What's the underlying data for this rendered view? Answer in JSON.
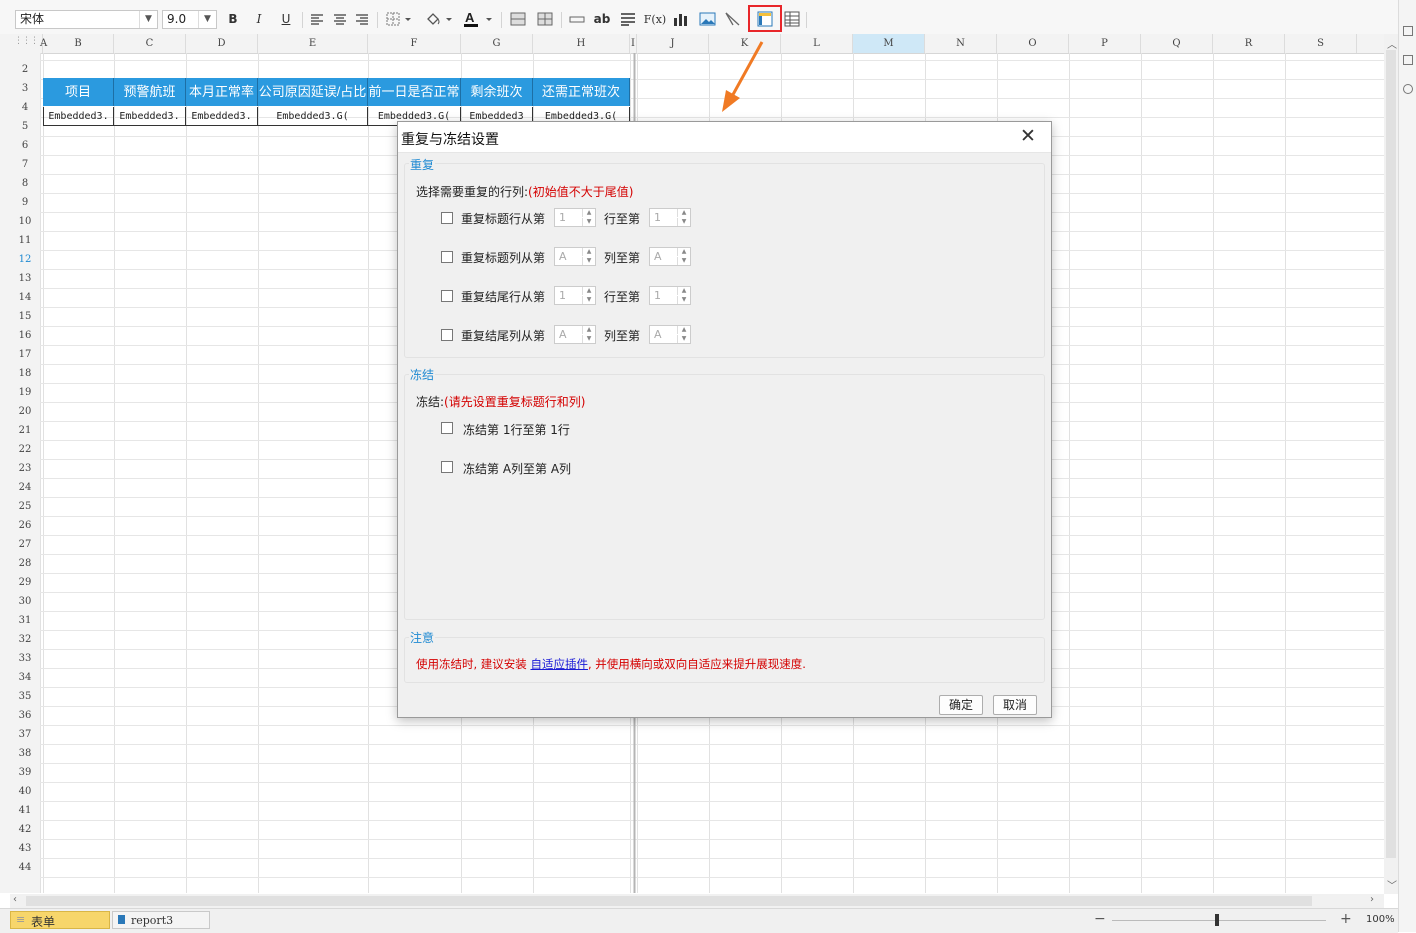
{
  "toolbar": {
    "font_name": "宋体",
    "font_size": "9.0",
    "bold_label": "B",
    "italic_label": "I",
    "underline_label": "U",
    "ab_label": "ab",
    "formula_label": "F(x)"
  },
  "columns": [
    "A",
    "B",
    "C",
    "D",
    "E",
    "F",
    "G",
    "H",
    "I",
    "J",
    "K",
    "L",
    "M",
    "N",
    "O",
    "P",
    "Q",
    "R",
    "S"
  ],
  "rows": [
    "2",
    "3",
    "4",
    "5",
    "6",
    "7",
    "8",
    "9",
    "10",
    "11",
    "12",
    "13",
    "14",
    "15",
    "16",
    "17",
    "18",
    "19",
    "20",
    "21",
    "22",
    "23",
    "24",
    "25",
    "26",
    "27",
    "28",
    "29",
    "30",
    "31",
    "32",
    "33",
    "34",
    "35",
    "36",
    "37",
    "38",
    "39",
    "40",
    "41",
    "42",
    "43",
    "44"
  ],
  "table": {
    "headers": [
      "项目",
      "预警航班",
      "本月正常率",
      "公司原因延误/占比",
      "前一日是否正常",
      "剩余班次",
      "还需正常班次"
    ],
    "cells": [
      "Embedded3.",
      "Embedded3.",
      "Embedded3.",
      "Embedded3.G(",
      "Embedded3.G(",
      "Embedded3",
      "Embedded3.G("
    ]
  },
  "dialog": {
    "title": "重复与冻结设置",
    "repeat": {
      "section_title": "重复",
      "prompt": "选择需要重复的行列:",
      "prompt_hint": "(初始值不大于尾值)",
      "items": [
        {
          "label": "重复标题行从第",
          "start": "1",
          "mid": "行至第",
          "end": "1"
        },
        {
          "label": "重复标题列从第",
          "start": "A",
          "mid": "列至第",
          "end": "A"
        },
        {
          "label": "重复结尾行从第",
          "start": "1",
          "mid": "行至第",
          "end": "1"
        },
        {
          "label": "重复结尾列从第",
          "start": "A",
          "mid": "列至第",
          "end": "A"
        }
      ]
    },
    "freeze": {
      "section_title": "冻结",
      "prompt": "冻结:",
      "prompt_hint": "(请先设置重复标题行和列)",
      "items": [
        "冻结第 1行至第 1行",
        "冻结第 A列至第 A列"
      ]
    },
    "note": {
      "section_title": "注意",
      "text_before": "使用冻结时, 建议安装",
      "link": "自适应插件",
      "text_after": ", 并使用横向或双向自适应来提升展现速度."
    },
    "ok_label": "确定",
    "cancel_label": "取消"
  },
  "bottom": {
    "tab_active": "表单",
    "tab_report": "report3",
    "zoom_minus": "−",
    "zoom_plus": "+",
    "zoom_value": "100%"
  },
  "colors": {
    "header_blue": "#2b9adf",
    "highlight_red": "#e8262a",
    "arrow_orange": "#f07a24",
    "section_title_blue": "#1f8ad2",
    "hint_red": "#d40000"
  }
}
